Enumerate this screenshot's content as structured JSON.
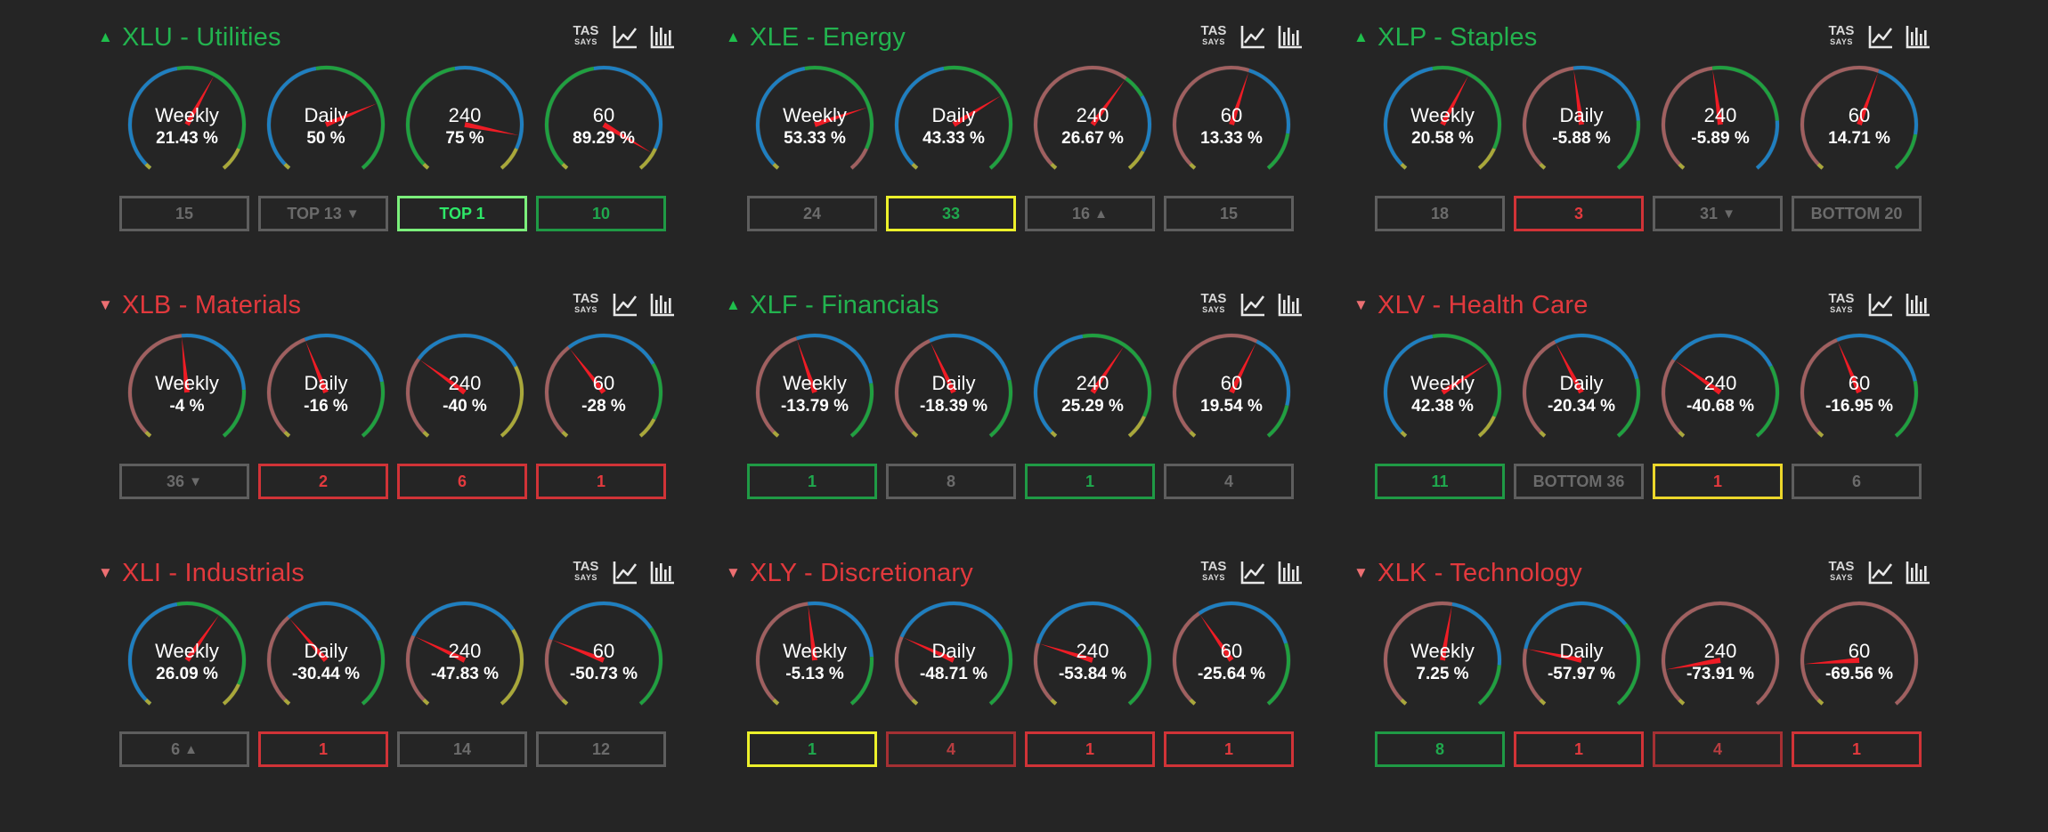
{
  "tools": {
    "tas_line1": "TAS",
    "tas_line2": "SAYS",
    "line_icon": "line-chart-icon",
    "bar_icon": "bar-chart-icon"
  },
  "colors": {
    "background": "#252525",
    "arc_blue": "#1f7fc0",
    "arc_green": "#20a040",
    "arc_red": "#a06060",
    "arc_olive": "#a9a83a",
    "arc_purple": "#7a6bd0",
    "needle": "#ee1c25",
    "title_up": "#23b34f",
    "title_down": "#e2393d"
  },
  "panels": [
    {
      "symbol": "XLU - Utilities",
      "trend": "up",
      "trend_icon": "▲",
      "gauges": [
        {
          "label": "Weekly",
          "value": "21.43 %",
          "pct": 21.43,
          "arcs": "bgo"
        },
        {
          "label": "Daily",
          "value": "50 %",
          "pct": 50,
          "arcs": "bg"
        },
        {
          "label": "240",
          "value": "75 %",
          "pct": 75,
          "arcs": "gbo"
        },
        {
          "label": "60",
          "value": "89.29 %",
          "pct": 89.29,
          "arcs": "gbo"
        }
      ],
      "boxes": [
        {
          "text": "15",
          "style": "grey",
          "arrow": ""
        },
        {
          "text": "TOP 13",
          "style": "grey",
          "arrow": "▼"
        },
        {
          "text": "TOP 1",
          "style": "green-bright",
          "arrow": ""
        },
        {
          "text": "10",
          "style": "green",
          "arrow": ""
        }
      ]
    },
    {
      "symbol": "XLE - Energy",
      "trend": "up",
      "trend_icon": "▲",
      "gauges": [
        {
          "label": "Weekly",
          "value": "53.33 %",
          "pct": 53.33,
          "arcs": "bgr"
        },
        {
          "label": "Daily",
          "value": "43.33 %",
          "pct": 43.33,
          "arcs": "bg"
        },
        {
          "label": "240",
          "value": "26.67 %",
          "pct": 26.67,
          "arcs": "rgbo"
        },
        {
          "label": "60",
          "value": "13.33 %",
          "pct": 13.33,
          "arcs": "rbg"
        }
      ],
      "boxes": [
        {
          "text": "24",
          "style": "grey",
          "arrow": ""
        },
        {
          "text": "33",
          "style": "yellow",
          "arrow": ""
        },
        {
          "text": "16",
          "style": "grey",
          "arrow": "▲"
        },
        {
          "text": "15",
          "style": "grey",
          "arrow": ""
        }
      ]
    },
    {
      "symbol": "XLP - Staples",
      "trend": "up",
      "trend_icon": "▲",
      "gauges": [
        {
          "label": "Weekly",
          "value": "20.58 %",
          "pct": 20.58,
          "arcs": "bgo"
        },
        {
          "label": "Daily",
          "value": "-5.88 %",
          "pct": -5.88,
          "arcs": "rbg"
        },
        {
          "label": "240",
          "value": "-5.89 %",
          "pct": -5.89,
          "arcs": "rgb"
        },
        {
          "label": "60",
          "value": "14.71 %",
          "pct": 14.71,
          "arcs": "rbg"
        }
      ],
      "boxes": [
        {
          "text": "18",
          "style": "grey",
          "arrow": ""
        },
        {
          "text": "3",
          "style": "red",
          "arrow": ""
        },
        {
          "text": "31",
          "style": "grey",
          "arrow": "▼"
        },
        {
          "text": "BOTTOM 20",
          "style": "grey",
          "arrow": ""
        }
      ]
    },
    {
      "symbol": "XLB - Materials",
      "trend": "down",
      "trend_icon": "▼",
      "gauges": [
        {
          "label": "Weekly",
          "value": "-4 %",
          "pct": -4,
          "arcs": "rbg"
        },
        {
          "label": "Daily",
          "value": "-16 %",
          "pct": -16,
          "arcs": "rbg"
        },
        {
          "label": "240",
          "value": "-40 %",
          "pct": -40,
          "arcs": "rbo"
        },
        {
          "label": "60",
          "value": "-28 %",
          "pct": -28,
          "arcs": "rbgo"
        }
      ],
      "boxes": [
        {
          "text": "36",
          "style": "grey",
          "arrow": "▼"
        },
        {
          "text": "2",
          "style": "red",
          "arrow": ""
        },
        {
          "text": "6",
          "style": "red",
          "arrow": ""
        },
        {
          "text": "1",
          "style": "red",
          "arrow": ""
        }
      ]
    },
    {
      "symbol": "XLF - Financials",
      "trend": "up",
      "trend_icon": "▲",
      "gauges": [
        {
          "label": "Weekly",
          "value": "-13.79 %",
          "pct": -13.79,
          "arcs": "rbg"
        },
        {
          "label": "Daily",
          "value": "-18.39 %",
          "pct": -18.39,
          "arcs": "rbg"
        },
        {
          "label": "240",
          "value": "25.29 %",
          "pct": 25.29,
          "arcs": "bgo"
        },
        {
          "label": "60",
          "value": "19.54 %",
          "pct": 19.54,
          "arcs": "rbg"
        }
      ],
      "boxes": [
        {
          "text": "1",
          "style": "green",
          "arrow": ""
        },
        {
          "text": "8",
          "style": "grey",
          "arrow": ""
        },
        {
          "text": "1",
          "style": "green",
          "arrow": ""
        },
        {
          "text": "4",
          "style": "grey",
          "arrow": ""
        }
      ]
    },
    {
      "symbol": "XLV - Health Care",
      "trend": "down",
      "trend_icon": "▼",
      "gauges": [
        {
          "label": "Weekly",
          "value": "42.38 %",
          "pct": 42.38,
          "arcs": "bgo"
        },
        {
          "label": "Daily",
          "value": "-20.34 %",
          "pct": -20.34,
          "arcs": "rbg"
        },
        {
          "label": "240",
          "value": "-40.68 %",
          "pct": -40.68,
          "arcs": "rbg"
        },
        {
          "label": "60",
          "value": "-16.95 %",
          "pct": -16.95,
          "arcs": "rbg"
        }
      ],
      "boxes": [
        {
          "text": "11",
          "style": "green",
          "arrow": ""
        },
        {
          "text": "BOTTOM 36",
          "style": "grey",
          "arrow": ""
        },
        {
          "text": "1",
          "style": "yellow-red",
          "arrow": ""
        },
        {
          "text": "6",
          "style": "grey",
          "arrow": ""
        }
      ]
    },
    {
      "symbol": "XLI - Industrials",
      "trend": "down",
      "trend_icon": "▼",
      "gauges": [
        {
          "label": "Weekly",
          "value": "26.09 %",
          "pct": 26.09,
          "arcs": "bgo"
        },
        {
          "label": "Daily",
          "value": "-30.44 %",
          "pct": -30.44,
          "arcs": "rbg"
        },
        {
          "label": "240",
          "value": "-47.83 %",
          "pct": -47.83,
          "arcs": "rbo"
        },
        {
          "label": "60",
          "value": "-50.73 %",
          "pct": -50.73,
          "arcs": "rbg"
        }
      ],
      "boxes": [
        {
          "text": "6",
          "style": "grey",
          "arrow": "▲"
        },
        {
          "text": "1",
          "style": "red",
          "arrow": ""
        },
        {
          "text": "14",
          "style": "grey",
          "arrow": ""
        },
        {
          "text": "12",
          "style": "grey",
          "arrow": ""
        }
      ]
    },
    {
      "symbol": "XLY - Discretionary",
      "trend": "down",
      "trend_icon": "▼",
      "gauges": [
        {
          "label": "Weekly",
          "value": "-5.13 %",
          "pct": -5.13,
          "arcs": "rbg"
        },
        {
          "label": "Daily",
          "value": "-48.71 %",
          "pct": -48.71,
          "arcs": "rbg"
        },
        {
          "label": "240",
          "value": "-53.84 %",
          "pct": -53.84,
          "arcs": "rbg"
        },
        {
          "label": "60",
          "value": "-25.64 %",
          "pct": -25.64,
          "arcs": "rbg"
        }
      ],
      "boxes": [
        {
          "text": "1",
          "style": "yellow",
          "arrow": ""
        },
        {
          "text": "4",
          "style": "red-dim",
          "arrow": ""
        },
        {
          "text": "1",
          "style": "red",
          "arrow": ""
        },
        {
          "text": "1",
          "style": "red",
          "arrow": ""
        }
      ]
    },
    {
      "symbol": "XLK - Technology",
      "trend": "down",
      "trend_icon": "▼",
      "gauges": [
        {
          "label": "Weekly",
          "value": "7.25 %",
          "pct": 7.25,
          "arcs": "rbg"
        },
        {
          "label": "Daily",
          "value": "-57.97 %",
          "pct": -57.97,
          "arcs": "rbg"
        },
        {
          "label": "240",
          "value": "-73.91 %",
          "pct": -73.91,
          "arcs": "r"
        },
        {
          "label": "60",
          "value": "-69.56 %",
          "pct": -69.56,
          "arcs": "r"
        }
      ],
      "boxes": [
        {
          "text": "8",
          "style": "green",
          "arrow": ""
        },
        {
          "text": "1",
          "style": "red",
          "arrow": ""
        },
        {
          "text": "4",
          "style": "red-dim",
          "arrow": ""
        },
        {
          "text": "1",
          "style": "red",
          "arrow": ""
        }
      ]
    }
  ]
}
